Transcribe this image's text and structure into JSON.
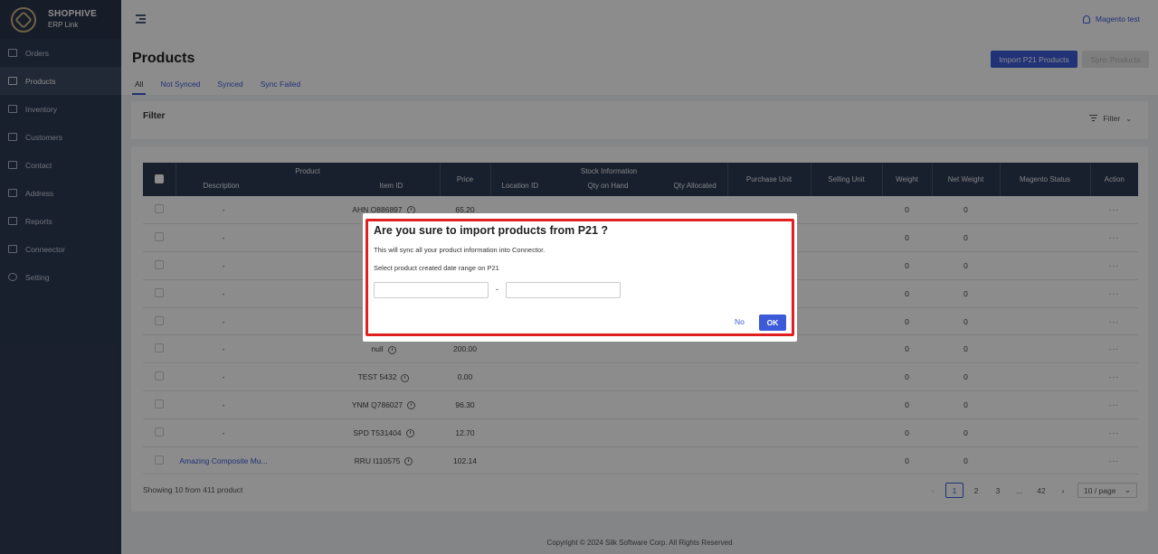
{
  "brand": {
    "name": "SHOPHIVE",
    "sub": "ERP Link"
  },
  "sidebar": {
    "items": [
      {
        "label": "Orders",
        "icon": "orders-icon"
      },
      {
        "label": "Products",
        "icon": "box-icon",
        "active": true
      },
      {
        "label": "Inventory",
        "icon": "inventory-icon"
      },
      {
        "label": "Customers",
        "icon": "customers-icon"
      },
      {
        "label": "Contact",
        "icon": "contact-icon"
      },
      {
        "label": "Address",
        "icon": "address-icon"
      },
      {
        "label": "Reports",
        "icon": "reports-icon"
      },
      {
        "label": "Conneector",
        "icon": "connector-icon"
      },
      {
        "label": "Setting",
        "icon": "gear-icon"
      }
    ]
  },
  "header": {
    "user": "Magento test"
  },
  "page": {
    "title": "Products",
    "tabs": [
      "All",
      "Not Synced",
      "Synced",
      "Sync Failed"
    ],
    "import_button": "Import P21 Products",
    "sync_button": "Sync Products"
  },
  "filter": {
    "title": "Filter",
    "button": "Filter"
  },
  "table": {
    "group_product": "Product",
    "group_stock": "Stock Information",
    "columns": {
      "description": "Description",
      "item_id": "Item ID",
      "price": "Price",
      "location_id": "Location ID",
      "qty_on_hand": "Qty on Hand",
      "qty_allocated": "Qty Allocated",
      "purchase_unit": "Purchase Unit",
      "selling_unit": "Selling Unit",
      "weight": "Weight",
      "net_weight": "Net Weight",
      "magento_status": "Magento Status",
      "action": "Action"
    },
    "rows": [
      {
        "description": "-",
        "item_id": "AHN O886897",
        "price": "65.20",
        "weight": "0",
        "net_weight": "0",
        "action": "···"
      },
      {
        "description": "-",
        "item_id": "",
        "price": "",
        "weight": "0",
        "net_weight": "0",
        "action": "···"
      },
      {
        "description": "-",
        "item_id": "",
        "price": "",
        "weight": "0",
        "net_weight": "0",
        "action": "···"
      },
      {
        "description": "-",
        "item_id": "",
        "price": "",
        "weight": "0",
        "net_weight": "0",
        "action": "···"
      },
      {
        "description": "-",
        "item_id": "",
        "price": "",
        "weight": "0",
        "net_weight": "0",
        "action": "···"
      },
      {
        "description": "-",
        "item_id": "null",
        "price": "200.00",
        "weight": "0",
        "net_weight": "0",
        "action": "···"
      },
      {
        "description": "-",
        "item_id": "TEST 5432",
        "price": "0.00",
        "weight": "0",
        "net_weight": "0",
        "action": "···"
      },
      {
        "description": "-",
        "item_id": "YNM Q786027",
        "price": "96.30",
        "weight": "0",
        "net_weight": "0",
        "action": "···"
      },
      {
        "description": "-",
        "item_id": "SPD T531404",
        "price": "12.70",
        "weight": "0",
        "net_weight": "0",
        "action": "···"
      },
      {
        "description": "Amazing Composite Mu...",
        "item_id": "RRU I110575",
        "price": "102.14",
        "weight": "0",
        "net_weight": "0",
        "action": "···"
      }
    ]
  },
  "footer": {
    "showing": "Showing 10 from 411 product",
    "pages": [
      "1",
      "2",
      "3",
      "...",
      "42"
    ],
    "page_size": "10 / page",
    "copyright": "Copyright © 2024 Silk Software Corp. All Rights Reserved"
  },
  "dialog": {
    "title": "Are you sure to import products from P21 ?",
    "message": "This will sync all your product information into Connector.",
    "date_label": "Select product created date range on P21",
    "start_value": "",
    "end_value": "",
    "separator": "-",
    "no_label": "No",
    "ok_label": "OK"
  }
}
